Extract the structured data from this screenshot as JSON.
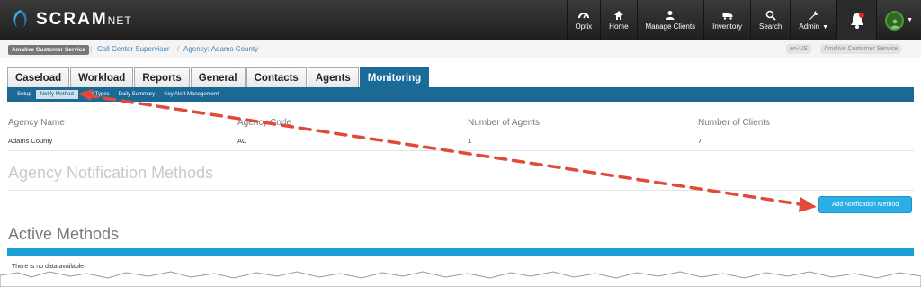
{
  "app": {
    "logo_text": "SCRAM",
    "logo_suffix": "NET"
  },
  "topnav": {
    "items": [
      {
        "label": "Optix",
        "icon": "dashboard-icon"
      },
      {
        "label": "Home",
        "icon": "home-icon"
      },
      {
        "label": "Manage Clients",
        "icon": "user-icon"
      },
      {
        "label": "Inventory",
        "icon": "truck-icon"
      },
      {
        "label": "Search",
        "icon": "search-icon"
      },
      {
        "label": "Admin",
        "icon": "wrench-icon"
      }
    ],
    "bell_icon": "bell-icon",
    "notification_color": "#e0281f"
  },
  "breadcrumb": {
    "org_badge": "Amslive Customer Service",
    "role": "Call Center Supervisor",
    "agency": "Agency: Adams County",
    "locale": "en-US",
    "org_right": "Amslive Customer Service"
  },
  "tabs": [
    {
      "label": "Caseload"
    },
    {
      "label": "Workload"
    },
    {
      "label": "Reports"
    },
    {
      "label": "General"
    },
    {
      "label": "Contacts"
    },
    {
      "label": "Agents"
    },
    {
      "label": "Monitoring",
      "active": true
    }
  ],
  "subnav": [
    {
      "label": "Setup"
    },
    {
      "label": "Notify Method",
      "active": true
    },
    {
      "label": "Alert Types"
    },
    {
      "label": "Daily Summary"
    },
    {
      "label": "Key Alert Management"
    }
  ],
  "agency_table": {
    "headers": [
      "Agency Name",
      "Agency Code",
      "Number of Agents",
      "Number of Clients"
    ],
    "values": [
      "Adams County",
      "AC",
      "1",
      "7"
    ]
  },
  "notification_section": {
    "title": "Agency Notification Methods",
    "add_button": "Add Notification Method"
  },
  "active_methods": {
    "title": "Active Methods",
    "empty_text": "There is no data available."
  },
  "colors": {
    "accent": "#1d6996",
    "button": "#2aaee6",
    "annotation_arrow": "#e04a3a"
  }
}
